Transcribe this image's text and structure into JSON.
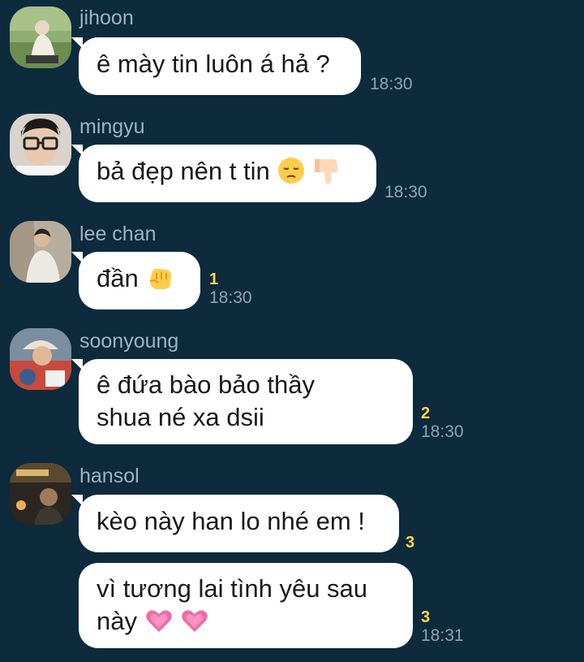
{
  "messages": [
    {
      "sender": "jihoon",
      "text": "ê mày tin luôn á hả ?",
      "unread": "",
      "time": "18:30",
      "avatar": "avatar-jihoon"
    },
    {
      "sender": "mingyu",
      "text": "bả đẹp nên t tin",
      "emojis": [
        "pensive-face-icon",
        "thumbs-down-icon"
      ],
      "unread": "",
      "time": "18:30",
      "avatar": "avatar-mingyu"
    },
    {
      "sender": "lee chan",
      "text": "đần",
      "emojis": [
        "fist-icon"
      ],
      "unread": "1",
      "time": "18:30",
      "avatar": "avatar-lee-chan"
    },
    {
      "sender": "soonyoung",
      "text_line1": "ê đứa bào bảo thầy",
      "text_line2": "shua né xa dsii",
      "unread": "2",
      "time": "18:30",
      "avatar": "avatar-soonyoung"
    },
    {
      "sender": "hansol",
      "text": "kèo này han lo nhé em !",
      "unread": "3",
      "time": "",
      "avatar": "avatar-hansol"
    },
    {
      "sender": "",
      "text_line1": "vì tương lai tình yêu sau",
      "text_line2": "này",
      "emojis": [
        "growing-heart-icon",
        "growing-heart-icon"
      ],
      "unread": "3",
      "time": "18:31"
    }
  ],
  "colors": {
    "background": "#0e2a3d",
    "bubble": "#ffffff",
    "sender_name": "#9fb3c1",
    "time": "#8fa3b1",
    "unread_count": "#ffd84d"
  }
}
